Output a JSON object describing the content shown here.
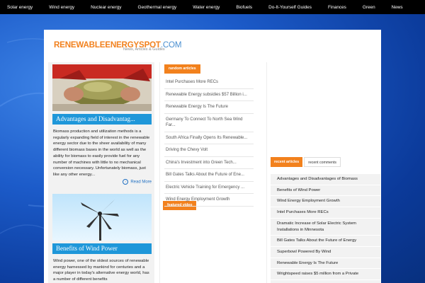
{
  "topnav": {
    "items": [
      "Solar energy",
      "Wind energy",
      "Nuclear energy",
      "Geothermal energy",
      "Water energy",
      "Biofuels",
      "Do-It-Yourself Guides",
      "Finances",
      "Green",
      "News"
    ]
  },
  "logo": {
    "brand_a": "RENEWABLE",
    "brand_b": "ENERGYSPOT",
    "brand_c": ".COM",
    "tagline": "News, Articles & Guides"
  },
  "posts": [
    {
      "title": "Advantages and Disadvantag...",
      "excerpt": "Biomass production and utilization methods is a regularly expanding field of interest in the renewable energy sector due to the sheer availability of many different biomass bases in the world as well as the ability for biomass to easily provide fuel for any number of machines with little to no mechanical conversion necessary. Unfortunately biomass, just like any other energy...",
      "read_more": "Read More"
    },
    {
      "title": "Benefits of Wind Power",
      "excerpt": "Wind power, one of the oldest sources of renewable energy harnessed by mankind for centuries and a major player in today's alternative energy world, has a number of different benefits"
    }
  ],
  "middle": {
    "random_label": "random articles",
    "featured_label": "featured video",
    "links": [
      "Intel Purchases More RECs",
      "Renewable Energy subsidies $57 Billion i...",
      "Renewable Energy Is The Future",
      "Germany To Connect To North Sea Wind Far...",
      "South Africa Finally Opens Its Renewable...",
      "Driving the Chevy Volt",
      "China's Investment into Green Tech...",
      "Bill Gates Talks About the Future of Ene...",
      "Electric Vehicle Training for Emergency ...",
      "Wind Energy Employment Growth"
    ]
  },
  "right": {
    "tab_recent_articles": "recent articles",
    "tab_recent_comments": "recent comments",
    "items": [
      "Advantages and Disadvantages of Biomass",
      "Benefits of Wind Power",
      "Wind Energy Employment Growth",
      "Intel Purchases More RECs",
      "Dramatic Increase of Solar Electric System Installations in Minnesota",
      "Bill Gates Talks About the Future of Energy",
      "Superbowl Powered By Wind",
      "Renewable Energy Is The Future",
      "Wrightspeed raises $5 million from a Private"
    ]
  },
  "colors": {
    "accent": "#f2811d",
    "title_bar": "#1f97d9",
    "link": "#1f6fc2"
  }
}
